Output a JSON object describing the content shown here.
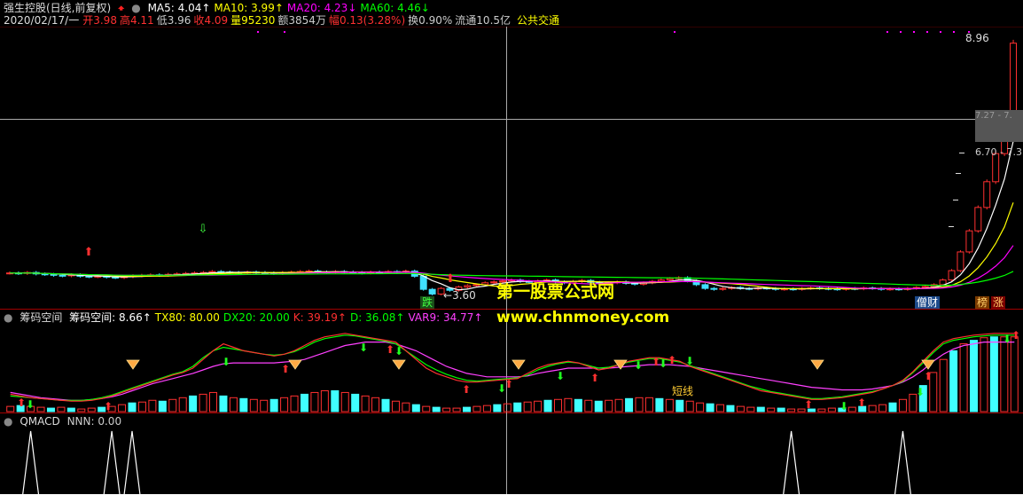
{
  "header": {
    "stock_title": "强生控股(日线,前复权)",
    "ma_items": [
      {
        "label": "MA5: ",
        "value": "4.04",
        "arrow": "↑",
        "color": "#ffffff"
      },
      {
        "label": "MA10: ",
        "value": "3.99",
        "arrow": "↑",
        "color": "#ffff00"
      },
      {
        "label": "MA20: ",
        "value": "4.23",
        "arrow": "↓",
        "color": "#ff00ff"
      },
      {
        "label": "MA60: ",
        "value": "4.46",
        "arrow": "↓",
        "color": "#00ff00"
      }
    ],
    "quote_date": "2020/02/17/一",
    "quote_items": [
      {
        "label": "开",
        "value": "3.98",
        "color": "#ff3030"
      },
      {
        "label": "高",
        "value": "4.11",
        "color": "#ff3030"
      },
      {
        "label": "低",
        "value": "3.96",
        "color": "#cccccc"
      },
      {
        "label": "收",
        "value": "4.09",
        "color": "#ff3030"
      },
      {
        "label": "量",
        "value": "95230",
        "color": "#ffff00"
      },
      {
        "label": "额",
        "value": "3854万",
        "color": "#cccccc"
      },
      {
        "label": "幅",
        "value": "0.13(3.28%)",
        "color": "#ff3030"
      },
      {
        "label": "换",
        "value": "0.90%",
        "color": "#cccccc"
      },
      {
        "label": "流通",
        "value": "10.5亿",
        "color": "#cccccc"
      }
    ],
    "concept": "公共交通"
  },
  "price_labels": {
    "high": "8.96",
    "low": "3.60",
    "right_band": "7.27 - 7.",
    "right_band2": "6.70 - 7.3",
    "tags": [
      {
        "text": "跌",
        "color": "#40ff40",
        "bg": "#1a4d1a"
      },
      {
        "text": "僧财",
        "color": "#ffffff",
        "bg": "#1d4a8a"
      },
      {
        "text": "榜",
        "color": "#ffcc66",
        "bg": "#7a3a00"
      },
      {
        "text": "涨",
        "color": "#ffcc66",
        "bg": "#7a0000"
      }
    ]
  },
  "watermark": {
    "title": "第一股票公式网",
    "url": "www.chnmoney.com"
  },
  "panel2": {
    "name": "筹码空间",
    "items": [
      {
        "label": "筹码空间: ",
        "value": "8.66",
        "arrow": "↑",
        "color": "#ffffff"
      },
      {
        "label": "TX80: ",
        "value": "80.00",
        "arrow": "",
        "color": "#ffff00"
      },
      {
        "label": "DX20: ",
        "value": "20.00",
        "arrow": "",
        "color": "#00ff00"
      },
      {
        "label": "K: ",
        "value": "39.19",
        "arrow": "↑",
        "color": "#ff3030"
      },
      {
        "label": "D: ",
        "value": "36.08",
        "arrow": "↑",
        "color": "#00ff00"
      },
      {
        "label": "VAR9: ",
        "value": "34.77",
        "arrow": "↑",
        "color": "#ff40ff"
      }
    ],
    "annotation": "短线"
  },
  "panel3": {
    "name": "QMACD",
    "items": [
      {
        "label": "NNN: ",
        "value": "0.00",
        "color": "#cccccc"
      }
    ]
  },
  "colors": {
    "up": "#ff3030",
    "down": "#40e0ff",
    "ma5": "#ffffff",
    "ma10": "#ffff00",
    "ma20": "#ff00ff",
    "ma60": "#00ff00",
    "border": "#a00000",
    "cyan": "#40ffff"
  },
  "chart_data": [
    {
      "type": "candlestick",
      "title": "强生控股(日线,前复权)",
      "ylim": [
        3.4,
        9.2
      ],
      "n_bars": 115,
      "close": [
        4.05,
        4.04,
        4.06,
        4.03,
        4.02,
        4.0,
        3.99,
        4.01,
        3.98,
        3.97,
        3.98,
        3.96,
        3.95,
        3.97,
        3.99,
        4.0,
        4.01,
        4.0,
        4.02,
        4.03,
        4.04,
        4.05,
        4.06,
        4.08,
        4.07,
        4.06,
        4.05,
        4.07,
        4.06,
        4.05,
        4.04,
        4.06,
        4.07,
        4.08,
        4.09,
        4.07,
        4.06,
        4.08,
        4.07,
        4.06,
        4.05,
        4.07,
        4.06,
        4.08,
        4.07,
        4.09,
        3.98,
        3.7,
        3.6,
        3.72,
        3.68,
        3.75,
        3.78,
        3.8,
        3.84,
        3.86,
        3.88,
        3.9,
        3.87,
        3.85,
        3.88,
        3.9,
        3.86,
        3.84,
        3.87,
        3.89,
        3.85,
        3.82,
        3.84,
        3.86,
        3.83,
        3.81,
        3.84,
        3.87,
        3.9,
        3.93,
        3.95,
        3.88,
        3.8,
        3.72,
        3.7,
        3.72,
        3.74,
        3.72,
        3.71,
        3.73,
        3.72,
        3.7,
        3.71,
        3.7,
        3.72,
        3.73,
        3.72,
        3.71,
        3.7,
        3.72,
        3.71,
        3.73,
        3.72,
        3.7,
        3.71,
        3.7,
        3.72,
        3.74,
        3.76,
        3.8,
        3.9,
        4.1,
        4.5,
        4.95,
        5.45,
        6.0,
        6.6,
        7.3,
        8.96
      ],
      "extremes": {
        "high": 8.96,
        "low": 3.6
      },
      "series": [
        {
          "name": "MA5",
          "last": 4.04
        },
        {
          "name": "MA10",
          "last": 3.99
        },
        {
          "name": "MA20",
          "last": 4.23
        },
        {
          "name": "MA60",
          "last": 4.46
        }
      ]
    },
    {
      "type": "bar",
      "title": "筹码空间",
      "ylim": [
        0,
        100
      ],
      "k": [
        20,
        18,
        16,
        15,
        14,
        13,
        12,
        12,
        13,
        15,
        18,
        22,
        26,
        30,
        34,
        38,
        42,
        45,
        50,
        60,
        70,
        78,
        74,
        70,
        68,
        66,
        64,
        66,
        70,
        76,
        82,
        86,
        88,
        90,
        88,
        86,
        84,
        82,
        80,
        70,
        60,
        50,
        44,
        40,
        36,
        34,
        34,
        35,
        36,
        37,
        38,
        44,
        50,
        54,
        56,
        58,
        56,
        52,
        48,
        50,
        54,
        58,
        60,
        62,
        62,
        60,
        58,
        52,
        48,
        44,
        40,
        36,
        32,
        28,
        24,
        22,
        20,
        18,
        16,
        14,
        14,
        15,
        16,
        18,
        20,
        22,
        26,
        30,
        36,
        46,
        58,
        70,
        80,
        84,
        86,
        88,
        89,
        90,
        90,
        90
      ],
      "d": [
        18,
        17,
        16,
        15,
        14,
        13,
        13,
        13,
        14,
        16,
        19,
        23,
        27,
        31,
        35,
        39,
        43,
        46,
        52,
        62,
        70,
        74,
        72,
        70,
        68,
        66,
        65,
        66,
        69,
        74,
        80,
        84,
        86,
        88,
        87,
        85,
        83,
        81,
        78,
        70,
        62,
        54,
        48,
        43,
        39,
        36,
        35,
        36,
        37,
        38,
        39,
        42,
        48,
        52,
        55,
        57,
        56,
        53,
        50,
        51,
        54,
        57,
        59,
        61,
        61,
        59,
        57,
        53,
        49,
        45,
        41,
        37,
        33,
        29,
        26,
        23,
        21,
        19,
        17,
        15,
        15,
        16,
        17,
        19,
        21,
        23,
        26,
        30,
        35,
        45,
        56,
        68,
        78,
        82,
        84,
        86,
        87,
        88,
        88,
        88
      ],
      "var9": [
        22,
        20,
        18,
        16,
        15,
        14,
        13,
        13,
        14,
        15,
        17,
        20,
        24,
        28,
        32,
        35,
        38,
        41,
        44,
        48,
        52,
        55,
        56,
        56,
        56,
        56,
        56,
        57,
        58,
        60,
        64,
        68,
        72,
        76,
        78,
        80,
        80,
        80,
        78,
        74,
        70,
        64,
        58,
        52,
        48,
        44,
        42,
        40,
        40,
        40,
        40,
        41,
        44,
        46,
        48,
        50,
        50,
        50,
        50,
        50,
        51,
        52,
        53,
        54,
        54,
        54,
        53,
        52,
        50,
        48,
        46,
        44,
        42,
        40,
        38,
        36,
        34,
        32,
        30,
        28,
        27,
        26,
        25,
        25,
        25,
        26,
        28,
        30,
        34,
        40,
        48,
        58,
        66,
        72,
        76,
        78,
        80,
        80,
        80,
        80
      ],
      "bars": [
        6,
        7,
        6,
        5,
        4,
        5,
        4,
        3,
        4,
        5,
        6,
        8,
        10,
        11,
        13,
        12,
        14,
        16,
        18,
        20,
        22,
        18,
        16,
        15,
        14,
        13,
        14,
        16,
        18,
        20,
        22,
        24,
        24,
        22,
        20,
        18,
        16,
        14,
        12,
        10,
        8,
        6,
        5,
        4,
        4,
        5,
        6,
        7,
        8,
        9,
        10,
        11,
        12,
        13,
        14,
        15,
        14,
        13,
        12,
        13,
        14,
        15,
        16,
        16,
        15,
        14,
        13,
        12,
        10,
        9,
        8,
        7,
        6,
        5,
        5,
        4,
        4,
        3,
        3,
        3,
        3,
        4,
        4,
        5,
        6,
        7,
        8,
        10,
        14,
        20,
        30,
        45,
        60,
        70,
        78,
        82,
        85,
        86,
        86,
        86
      ],
      "bar_up": [
        1,
        0,
        1,
        1,
        0,
        1,
        0,
        1,
        1,
        0,
        1,
        1,
        0,
        1,
        1,
        0,
        1,
        1,
        0,
        1,
        1,
        0,
        1,
        0,
        1,
        1,
        0,
        1,
        1,
        0,
        1,
        1,
        0,
        1,
        0,
        1,
        1,
        0,
        1,
        1,
        0,
        1,
        0,
        1,
        1,
        0,
        1,
        1,
        0,
        1,
        0,
        1,
        1,
        0,
        1,
        1,
        0,
        1,
        0,
        1,
        1,
        0,
        1,
        1,
        0,
        1,
        0,
        1,
        1,
        0,
        1,
        0,
        1,
        1,
        0,
        1,
        0,
        1,
        1,
        0,
        1,
        1,
        0,
        1,
        0,
        1,
        1,
        0,
        1,
        1,
        0,
        1,
        1,
        0,
        1,
        0,
        1,
        0,
        1,
        1
      ],
      "series": [
        {
          "name": "筹码空间",
          "last": 8.66
        },
        {
          "name": "TX80",
          "last": 80.0
        },
        {
          "name": "DX20",
          "last": 20.0
        },
        {
          "name": "K",
          "last": 39.19
        },
        {
          "name": "D",
          "last": 36.08
        },
        {
          "name": "VAR9",
          "last": 34.77
        }
      ]
    },
    {
      "type": "line",
      "title": "QMACD",
      "ylim": [
        0,
        1
      ],
      "spikes": [
        2,
        10,
        12,
        77,
        88
      ],
      "series": [
        {
          "name": "NNN",
          "last": 0.0
        }
      ]
    }
  ]
}
